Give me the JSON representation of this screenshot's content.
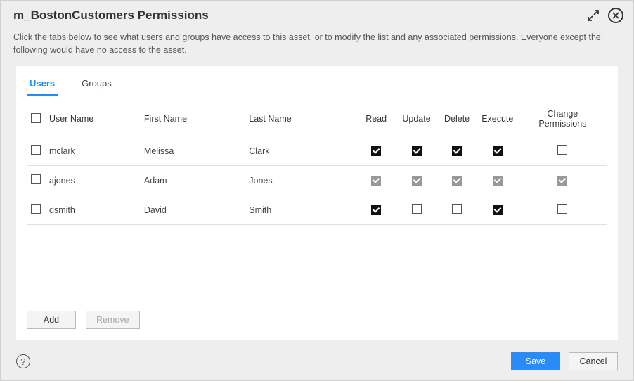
{
  "titlebar": {
    "title": "m_BostonCustomers Permissions"
  },
  "description": "Click the tabs below to see what users and groups have access to this asset, or to modify the list and any associated permissions. Everyone except the following would have no access to the asset.",
  "tabs": [
    "Users",
    "Groups"
  ],
  "activeTab": "Users",
  "columns": {
    "user": "User Name",
    "first": "First Name",
    "last": "Last Name",
    "read": "Read",
    "update": "Update",
    "delete": "Delete",
    "execute": "Execute",
    "change": "Change Permissions"
  },
  "rows": [
    {
      "user": "mclark",
      "first": "Melissa",
      "last": "Clark",
      "read": true,
      "update": true,
      "delete": true,
      "execute": true,
      "change": false,
      "disabled": false
    },
    {
      "user": "ajones",
      "first": "Adam",
      "last": "Jones",
      "read": true,
      "update": true,
      "delete": true,
      "execute": true,
      "change": true,
      "disabled": true
    },
    {
      "user": "dsmith",
      "first": "David",
      "last": "Smith",
      "read": true,
      "update": false,
      "delete": false,
      "execute": true,
      "change": false,
      "disabled": false
    }
  ],
  "panelButtons": {
    "add": "Add",
    "remove": "Remove"
  },
  "footerButtons": {
    "save": "Save",
    "cancel": "Cancel"
  }
}
